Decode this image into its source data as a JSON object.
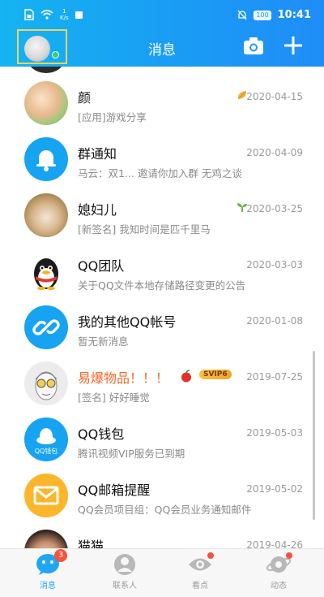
{
  "status_bar": {
    "speed_value": "1",
    "speed_unit": "K/s",
    "battery": "100",
    "time": "10:41"
  },
  "header": {
    "title": "消息"
  },
  "chats": [
    {
      "name": "颜",
      "preview": "[应用]游戏分享",
      "time": "2020-04-15",
      "badge_icon": "gold-leaf-icon"
    },
    {
      "name": "群通知",
      "preview": "马云：双1... 邀请你加入群 无鸡之谈",
      "time": "2020-04-09",
      "avatar_icon": "bell-icon"
    },
    {
      "name": "媳妇儿",
      "preview": "[新签名] 我知时间是匹千里马",
      "time": "2020-03-25",
      "badge_icon": "sprout-icon"
    },
    {
      "name": "QQ团队",
      "preview": "关于QQ文件本地存储路径变更的公告",
      "time": "2020-03-03",
      "avatar_icon": "penguin-icon"
    },
    {
      "name": "我的其他QQ帐号",
      "preview": "暂无新消息",
      "time": "2020-01-08",
      "avatar_icon": "link-icon"
    },
    {
      "name": "易爆物品！！！",
      "preview": "[签名] 好好睡觉",
      "time": "2019-07-25",
      "svip": "SVIP6",
      "badge_icon": "apple-icon"
    },
    {
      "name": "QQ钱包",
      "preview": "腾讯视频VIP服务已到期",
      "time": "2019-05-03",
      "avatar_icon": "wallet-icon",
      "avatar_text": "QQ钱包"
    },
    {
      "name": "QQ邮箱提醒",
      "preview": "QQ会员项目组：QQ会员业务通知邮件",
      "time": "2019-05-02",
      "avatar_icon": "mail-icon"
    },
    {
      "name": "猫猫",
      "preview": "",
      "time": "2019-04-26"
    }
  ],
  "tabs": [
    {
      "label": "消息",
      "count": "3"
    },
    {
      "label": "联系人"
    },
    {
      "label": "看点"
    },
    {
      "label": "动态"
    }
  ],
  "colors": {
    "accent": "#1a9cf5",
    "hot_name": "#f2692b",
    "badge_red": "#f5533d"
  }
}
